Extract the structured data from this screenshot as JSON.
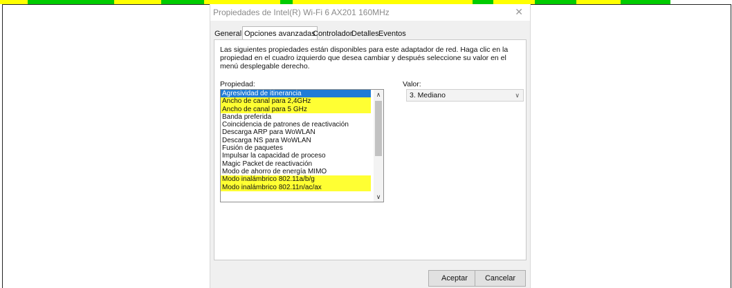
{
  "top_strip_colors": [
    "#ffff00",
    "#00cc00",
    "#ffff00",
    "#00cc00",
    "#ffff00",
    "#00cc00",
    "#ffff00",
    "#00cc00",
    "#ffff00",
    "#00cc00",
    "#ffff00",
    "#00cc00",
    "#ffffff"
  ],
  "dialog": {
    "title": "Propiedades de Intel(R) Wi-Fi 6 AX201 160MHz",
    "close_icon": "close-icon"
  },
  "tabs": [
    {
      "label": "General"
    },
    {
      "label": "Opciones avanzadas"
    },
    {
      "label": "Controlador"
    },
    {
      "label": "Detalles"
    },
    {
      "label": "Eventos"
    }
  ],
  "description": "Las siguientes propiedades están disponibles para este adaptador de red. Haga clic en la propiedad en el cuadro izquierdo que desea cambiar y después seleccione su valor en el menú desplegable derecho.",
  "property_label": "Propiedad:",
  "value_label": "Valor:",
  "properties": [
    {
      "label": "Agresividad de itinerancia",
      "selected": true,
      "highlighted": false
    },
    {
      "label": "Ancho de canal para 2,4GHz",
      "selected": false,
      "highlighted": true
    },
    {
      "label": "Ancho de canal para 5 GHz",
      "selected": false,
      "highlighted": true
    },
    {
      "label": "Banda preferida",
      "selected": false,
      "highlighted": false
    },
    {
      "label": "Coincidencia de patrones de reactivación",
      "selected": false,
      "highlighted": false
    },
    {
      "label": "Descarga ARP para WoWLAN",
      "selected": false,
      "highlighted": false
    },
    {
      "label": "Descarga NS para WoWLAN",
      "selected": false,
      "highlighted": false
    },
    {
      "label": "Fusión de paquetes",
      "selected": false,
      "highlighted": false
    },
    {
      "label": "Impulsar la capacidad de proceso",
      "selected": false,
      "highlighted": false
    },
    {
      "label": "Magic Packet de reactivación",
      "selected": false,
      "highlighted": false
    },
    {
      "label": "Modo de ahorro de energía MIMO",
      "selected": false,
      "highlighted": false
    },
    {
      "label": "Modo inalámbrico 802.11a/b/g",
      "selected": false,
      "highlighted": true
    },
    {
      "label": "Modo inalámbrico 802.11n/ac/ax",
      "selected": false,
      "highlighted": true
    }
  ],
  "value_selected": "3. Mediano",
  "buttons": {
    "ok": "Aceptar",
    "cancel": "Cancelar"
  },
  "colors": {
    "selection": "#1f7bd6",
    "highlight": "#ffff33"
  }
}
